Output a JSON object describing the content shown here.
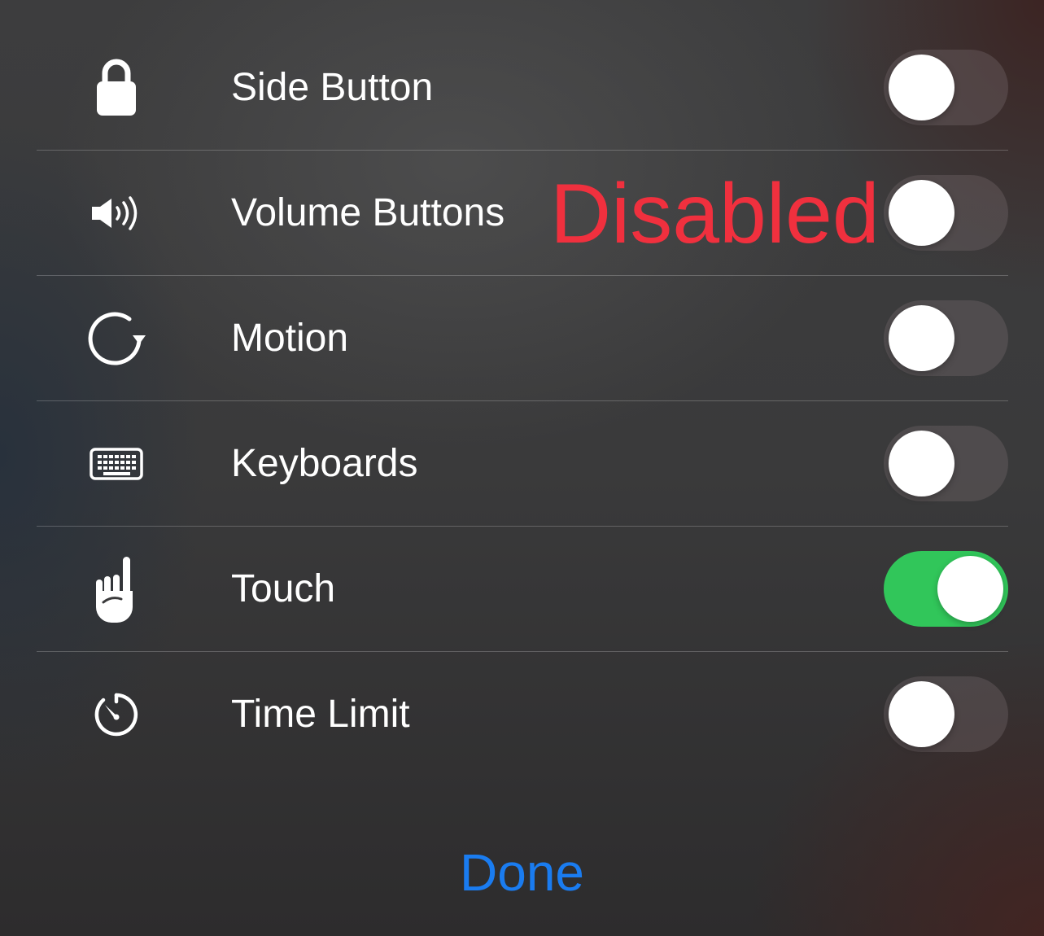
{
  "settings": {
    "rows": [
      {
        "label": "Side Button",
        "icon": "lock-icon",
        "enabled": false
      },
      {
        "label": "Volume Buttons",
        "icon": "speaker-volume-icon",
        "enabled": false
      },
      {
        "label": "Motion",
        "icon": "rotate-arrow-icon",
        "enabled": false
      },
      {
        "label": "Keyboards",
        "icon": "keyboard-icon",
        "enabled": false
      },
      {
        "label": "Touch",
        "icon": "pointing-hand-icon",
        "enabled": true
      },
      {
        "label": "Time Limit",
        "icon": "timer-icon",
        "enabled": false
      }
    ]
  },
  "annotation": {
    "text": "Disabled",
    "color": "#f0303e"
  },
  "footer": {
    "done_label": "Done"
  },
  "colors": {
    "toggle_on": "#31c65a",
    "done_link": "#1a7cf0"
  }
}
